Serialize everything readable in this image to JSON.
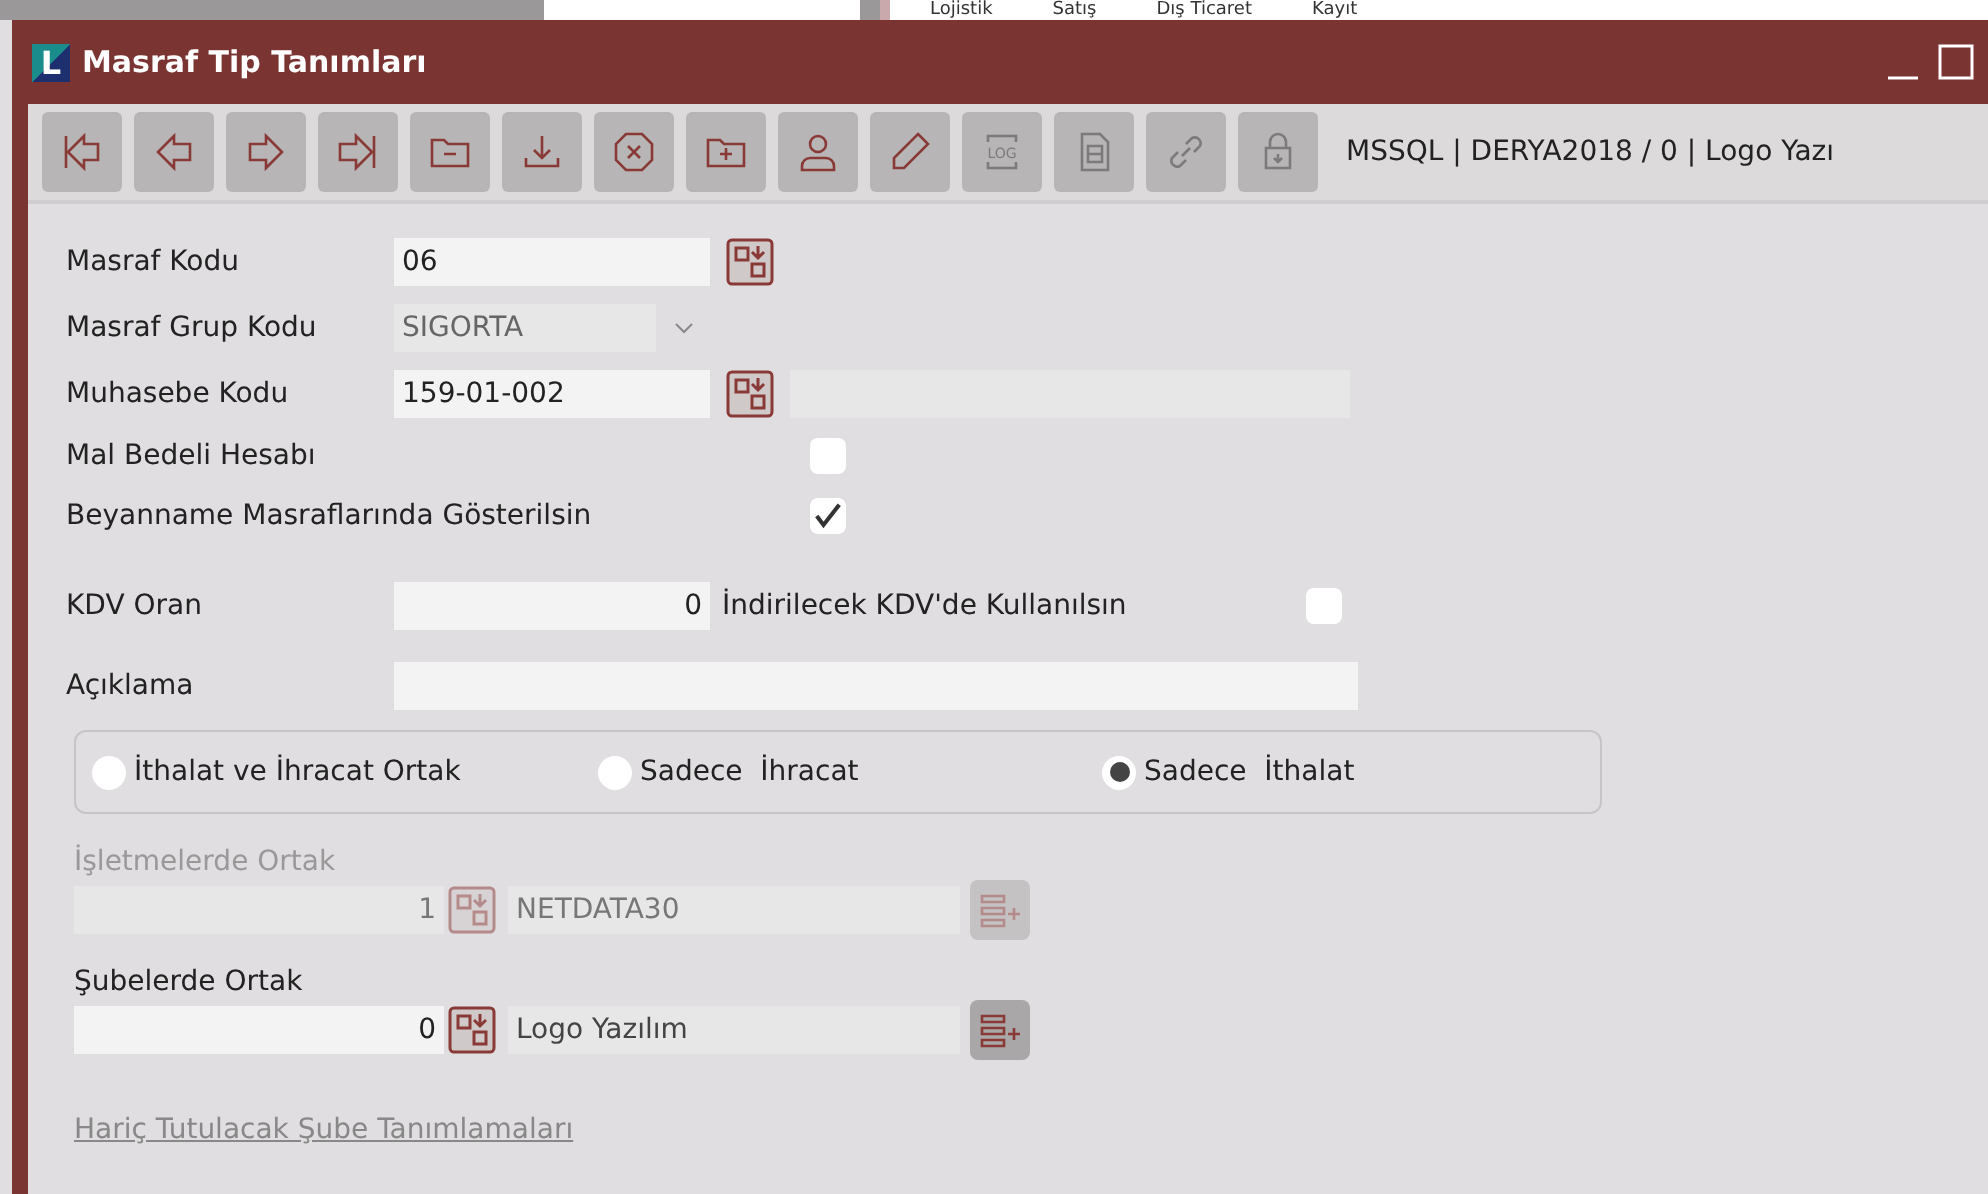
{
  "background_menu": [
    "Lojistik",
    "Satış",
    "Dış Ticaret",
    "Kayıt"
  ],
  "window": {
    "logo_letter": "L",
    "title": "Masraf Tip Tanımları"
  },
  "toolbar": {
    "buttons": [
      {
        "disabled": false
      },
      {
        "disabled": false
      },
      {
        "disabled": false
      },
      {
        "disabled": false
      },
      {
        "disabled": false
      },
      {
        "disabled": false
      },
      {
        "disabled": false
      },
      {
        "disabled": false
      },
      {
        "disabled": false
      },
      {
        "disabled": false
      },
      {
        "label": "LOG",
        "disabled": true
      },
      {
        "disabled": true
      },
      {
        "disabled": true
      },
      {
        "disabled": true
      }
    ],
    "connection": "MSSQL | DERYA2018 / 0 | Logo Yazı"
  },
  "form": {
    "masraf_kodu": {
      "label": "Masraf Kodu",
      "value": "06"
    },
    "masraf_grup_kodu": {
      "label": "Masraf Grup Kodu",
      "value": "SIGORTA"
    },
    "muhasebe_kodu": {
      "label": "Muhasebe Kodu",
      "value": "159-01-002"
    },
    "mal_bedeli_hesabi": {
      "label": "Mal Bedeli Hesabı",
      "checked": false
    },
    "beyanname": {
      "label": "Beyanname Masraflarında Gösterilsin",
      "checked": true
    },
    "kdv_oran": {
      "label": "KDV Oran",
      "value": "0"
    },
    "indirilecek_kdv": {
      "label": "İndirilecek KDV'de Kullanılsın",
      "checked": false
    },
    "aciklama": {
      "label": "Açıklama"
    }
  },
  "trade_options": [
    {
      "label": "İthalat ve İhracat Ortak",
      "selected": false
    },
    {
      "label": "Sadece  İhracat",
      "selected": false
    },
    {
      "label": "Sadece  İthalat",
      "selected": true
    }
  ],
  "sharing": [
    {
      "label": "İşletmelerde Ortak",
      "disabled": true,
      "number": "1",
      "name": "NETDATA30"
    },
    {
      "label": "Şubelerde Ortak",
      "disabled": false,
      "number": "0",
      "name": "Logo Yazılım"
    }
  ],
  "link": "Hariç Tutulacak Şube Tanımlamaları"
}
